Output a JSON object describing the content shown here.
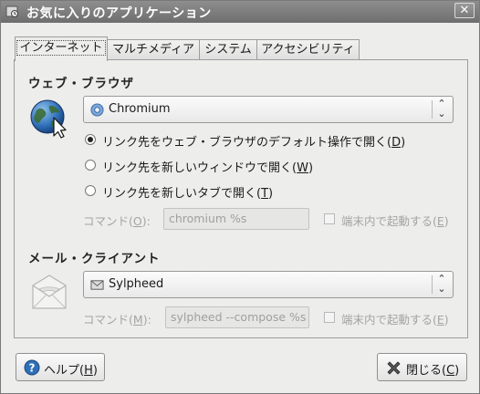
{
  "window": {
    "title": "お気に入りのアプリケーション",
    "close_glyph": "✕"
  },
  "tabs": [
    {
      "label": "インターネット",
      "active": true
    },
    {
      "label": "マルチメディア",
      "active": false
    },
    {
      "label": "システム",
      "active": false
    },
    {
      "label": "アクセシビリティ",
      "active": false
    }
  ],
  "browser": {
    "section_title": "ウェブ・ブラウザ",
    "selected": "Chromium",
    "radio_options": [
      {
        "prefix": "リンク先をウェブ・ブラウザのデフォルト操作で開く(",
        "mnemonic": "D",
        "suffix": ")",
        "selected": true
      },
      {
        "prefix": "リンク先を新しいウィンドウで開く(",
        "mnemonic": "W",
        "suffix": ")",
        "selected": false
      },
      {
        "prefix": "リンク先を新しいタブで開く(",
        "mnemonic": "T",
        "suffix": ")",
        "selected": false
      }
    ],
    "command_label_prefix": "コマンド(",
    "command_label_mnemonic": "O",
    "command_label_suffix": "):",
    "command_value": "chromium %s",
    "terminal_prefix": "端末内で起動する(",
    "terminal_mnemonic": "E",
    "terminal_suffix": ")"
  },
  "mail": {
    "section_title": "メール・クライアント",
    "selected": "Sylpheed",
    "command_label_prefix": "コマンド(",
    "command_label_mnemonic": "M",
    "command_label_suffix": "):",
    "command_value": "sylpheed --compose %s",
    "terminal_prefix": "端末内で起動する(",
    "terminal_mnemonic": "E",
    "terminal_suffix": ")"
  },
  "buttons": {
    "help_prefix": "ヘルプ(",
    "help_mnemonic": "H",
    "help_suffix": ")",
    "close_prefix": "閉じる(",
    "close_mnemonic": "C",
    "close_suffix": ")"
  },
  "colors": {
    "titlebar": "#7e7e7e",
    "background": "#ededec",
    "help_blue": "#2f6fb8",
    "close_red": "#8a3a3a"
  }
}
